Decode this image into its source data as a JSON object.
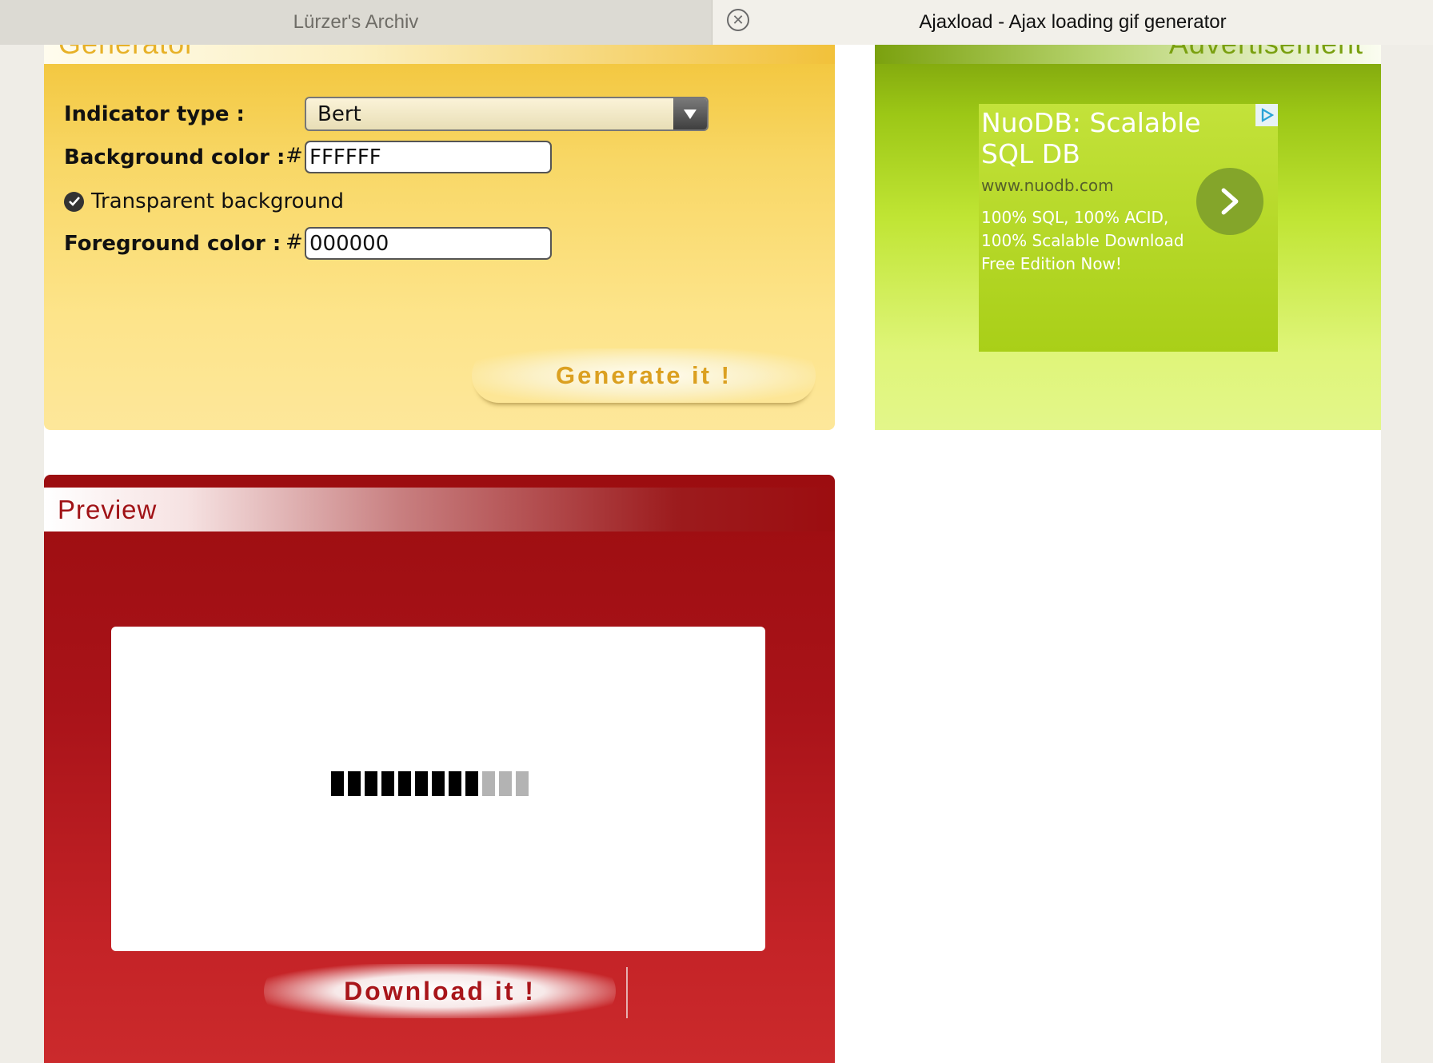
{
  "browser": {
    "tabs": [
      {
        "title": "Lürzer's Archiv",
        "active": false
      },
      {
        "title": "Ajaxload - Ajax loading gif generator",
        "active": true
      }
    ]
  },
  "generator": {
    "header_title": "Generator",
    "indicator_type_label": "Indicator type :",
    "indicator_type_value": "Bert",
    "background_color_label": "Background color :",
    "background_color_hash": "#",
    "background_color_value": "FFFFFF",
    "transparent_label": "Transparent background",
    "transparent_checked": true,
    "foreground_color_label": "Foreground color :",
    "foreground_color_hash": "#",
    "foreground_color_value": "000000",
    "generate_button": "Generate it !"
  },
  "advertisement": {
    "header_title": "Advertisement",
    "ad_title": "NuoDB: Scalable SQL DB",
    "ad_url": "www.nuodb.com",
    "ad_description": "100% SQL, 100% ACID, 100% Scalable Download Free Edition Now!"
  },
  "preview": {
    "header_title": "Preview",
    "loader_bars": {
      "dark_count": 9,
      "light_count": 3,
      "dark_color": "#000000",
      "light_color": "#b3b3b3"
    },
    "download_button": "Download it !"
  },
  "colors": {
    "generator_accent": "#f2c53a",
    "ad_accent": "#9cc716",
    "preview_accent": "#a91319"
  }
}
